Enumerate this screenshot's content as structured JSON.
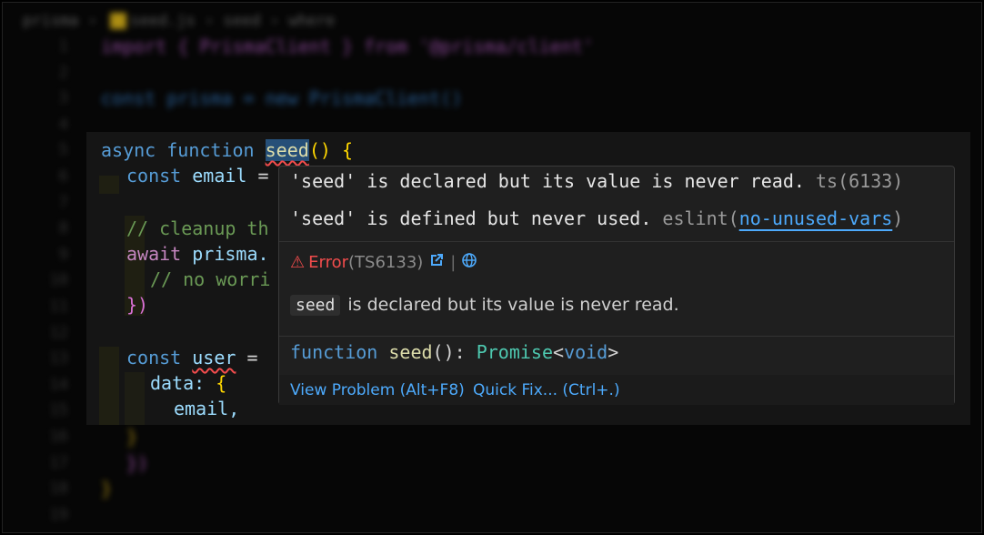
{
  "breadcrumb": [
    "prisma",
    "seed.js",
    "seed",
    "where"
  ],
  "background_code": [
    {
      "ln": "1",
      "text": "import { PrismaClient } from '@prisma/client'"
    },
    {
      "ln": "2",
      "text": ""
    },
    {
      "ln": "3",
      "text": "const prisma = new PrismaClient()"
    },
    {
      "ln": "4",
      "text": ""
    },
    {
      "ln": "5",
      "text": ""
    },
    {
      "ln": "6",
      "text": ""
    },
    {
      "ln": "7",
      "text": ""
    },
    {
      "ln": "8",
      "text": ""
    },
    {
      "ln": "9",
      "text": ""
    },
    {
      "ln": "10",
      "text": ""
    },
    {
      "ln": "11",
      "text": ""
    },
    {
      "ln": "12",
      "text": ""
    },
    {
      "ln": "13",
      "text": ""
    },
    {
      "ln": "14",
      "text": ""
    },
    {
      "ln": "15",
      "text": ""
    },
    {
      "ln": "16",
      "text": "}"
    },
    {
      "ln": "17",
      "text": "})"
    },
    {
      "ln": "18",
      "text": "}"
    },
    {
      "ln": "19",
      "text": ""
    }
  ],
  "focus_code": {
    "l1_async": "async",
    "l1_function": "function",
    "l1_name": "seed",
    "l1_paren": "()",
    "l1_brace": "{",
    "l2_const": "const",
    "l2_var": "email",
    "l2_eq": "=",
    "l3_comment": "// cleanup th",
    "l4_await": "await",
    "l4_obj": "prisma.",
    "l5_comment": "// no worri",
    "l6_close": "})",
    "l7_const": "const",
    "l7_var": "user",
    "l7_eq": "=",
    "l8_key": "data:",
    "l8_brace": "{",
    "l9_val": "email,"
  },
  "hover": {
    "msg1_main": "'seed' is declared but its value is never read.",
    "msg1_src": "ts(6133)",
    "msg2_main": "'seed' is defined but never used.",
    "msg2_src_prefix": "eslint(",
    "msg2_rule": "no-unused-vars",
    "msg2_src_suffix": ")",
    "error_label": "Error",
    "error_code": "(TS6133)",
    "desc_chip": "seed",
    "desc_text": "is declared but its value is never read.",
    "sig_kw": "function",
    "sig_name": "seed",
    "sig_paren": "():",
    "sig_type": "Promise",
    "sig_lt": "<",
    "sig_void": "void",
    "sig_gt": ">",
    "view_problem": "View Problem (Alt+F8)",
    "quick_fix": "Quick Fix... (Ctrl+.)"
  },
  "colors": {
    "error": "#f14c4c",
    "link": "#4daafc",
    "keyword": "#569cd6",
    "function": "#dcdcaa"
  }
}
